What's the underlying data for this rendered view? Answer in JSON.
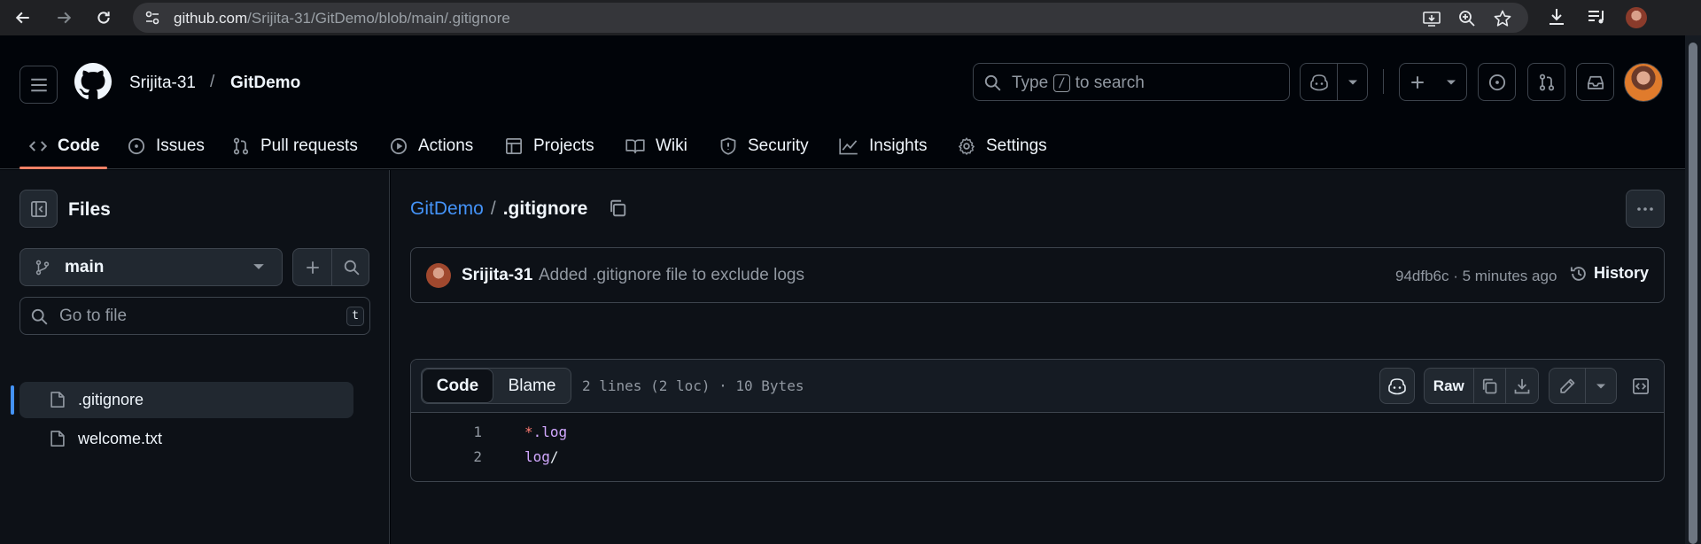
{
  "browser": {
    "url_host": "github.com",
    "url_path": "/Srijita-31/GitDemo/blob/main/.gitignore",
    "icons": [
      "back-icon",
      "forward-icon",
      "reload-icon",
      "site-info-icon",
      "install-app-icon",
      "zoom-icon",
      "bookmark-star-icon",
      "downloads-icon",
      "media-control-icon",
      "profile-avatar"
    ]
  },
  "header": {
    "owner": "Srijita-31",
    "separator": "/",
    "repo": "GitDemo",
    "search": {
      "prefix": "Type",
      "key": "/",
      "suffix": "to search"
    }
  },
  "tabs": [
    {
      "label": "Code",
      "icon": "code-icon",
      "active": true
    },
    {
      "label": "Issues",
      "icon": "issue-opened-icon"
    },
    {
      "label": "Pull requests",
      "icon": "git-pull-request-icon"
    },
    {
      "label": "Actions",
      "icon": "play-icon"
    },
    {
      "label": "Projects",
      "icon": "table-icon"
    },
    {
      "label": "Wiki",
      "icon": "book-icon"
    },
    {
      "label": "Security",
      "icon": "shield-icon"
    },
    {
      "label": "Insights",
      "icon": "graph-icon"
    },
    {
      "label": "Settings",
      "icon": "gear-icon"
    }
  ],
  "sidebar": {
    "title": "Files",
    "branch": "main",
    "goto_placeholder": "Go to file",
    "goto_shortcut": "t",
    "files": [
      {
        "name": ".gitignore",
        "selected": true
      },
      {
        "name": "welcome.txt",
        "selected": false
      }
    ]
  },
  "breadcrumb": {
    "repo": "GitDemo",
    "separator": "/",
    "file": ".gitignore"
  },
  "commit": {
    "author": "Srijita-31",
    "message": "Added .gitignore file to exclude logs",
    "meta": "94dfb6c · 5 minutes ago",
    "history_label": "History"
  },
  "viewer": {
    "tab_code": "Code",
    "tab_blame": "Blame",
    "info": "2 lines (2 loc) · 10 Bytes",
    "raw_label": "Raw",
    "lines": [
      {
        "num": "1",
        "parts": [
          {
            "text": "*",
            "cls": "p"
          },
          {
            "text": ".log",
            "cls": "t"
          }
        ]
      },
      {
        "num": "2",
        "parts": [
          {
            "text": "log",
            "cls": "t"
          },
          {
            "text": "/",
            "cls": ""
          }
        ]
      }
    ]
  },
  "colors": {
    "accent": "#4493f8",
    "tab_underline": "#f78166",
    "bg": "#0d1117",
    "header_bg": "#010409"
  }
}
